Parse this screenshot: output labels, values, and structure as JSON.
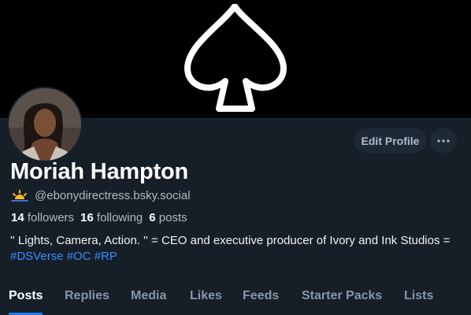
{
  "profile": {
    "name": "Moriah Hampton",
    "handle": "@ebonydirectress.bsky.social",
    "bio_text": "'' Lights, Camera, Action. '' = CEO and executive producer of Ivory and Ink Studios = ",
    "hashtags": [
      "#DSVerse",
      "#OC",
      "#RP"
    ]
  },
  "stats": {
    "followers_count": "14",
    "followers_label": "followers",
    "following_count": "16",
    "following_label": "following",
    "posts_count": "6",
    "posts_label": "posts"
  },
  "actions": {
    "edit_profile_label": "Edit Profile"
  },
  "tabs": [
    {
      "label": "Posts",
      "active": true
    },
    {
      "label": "Replies",
      "active": false
    },
    {
      "label": "Media",
      "active": false
    },
    {
      "label": "Likes",
      "active": false
    },
    {
      "label": "Feeds",
      "active": false
    },
    {
      "label": "Starter Packs",
      "active": false
    },
    {
      "label": "Lists",
      "active": false
    }
  ],
  "icons": {
    "banner": "spade-icon",
    "more": "ellipsis-icon",
    "handle_badge": "sunrise-icon"
  },
  "colors": {
    "background": "#161e27",
    "banner": "#000000",
    "accent": "#1d7df0",
    "hashtag": "#3b8eff",
    "muted_text": "#aebbc9",
    "button_bg": "#1e2936"
  }
}
